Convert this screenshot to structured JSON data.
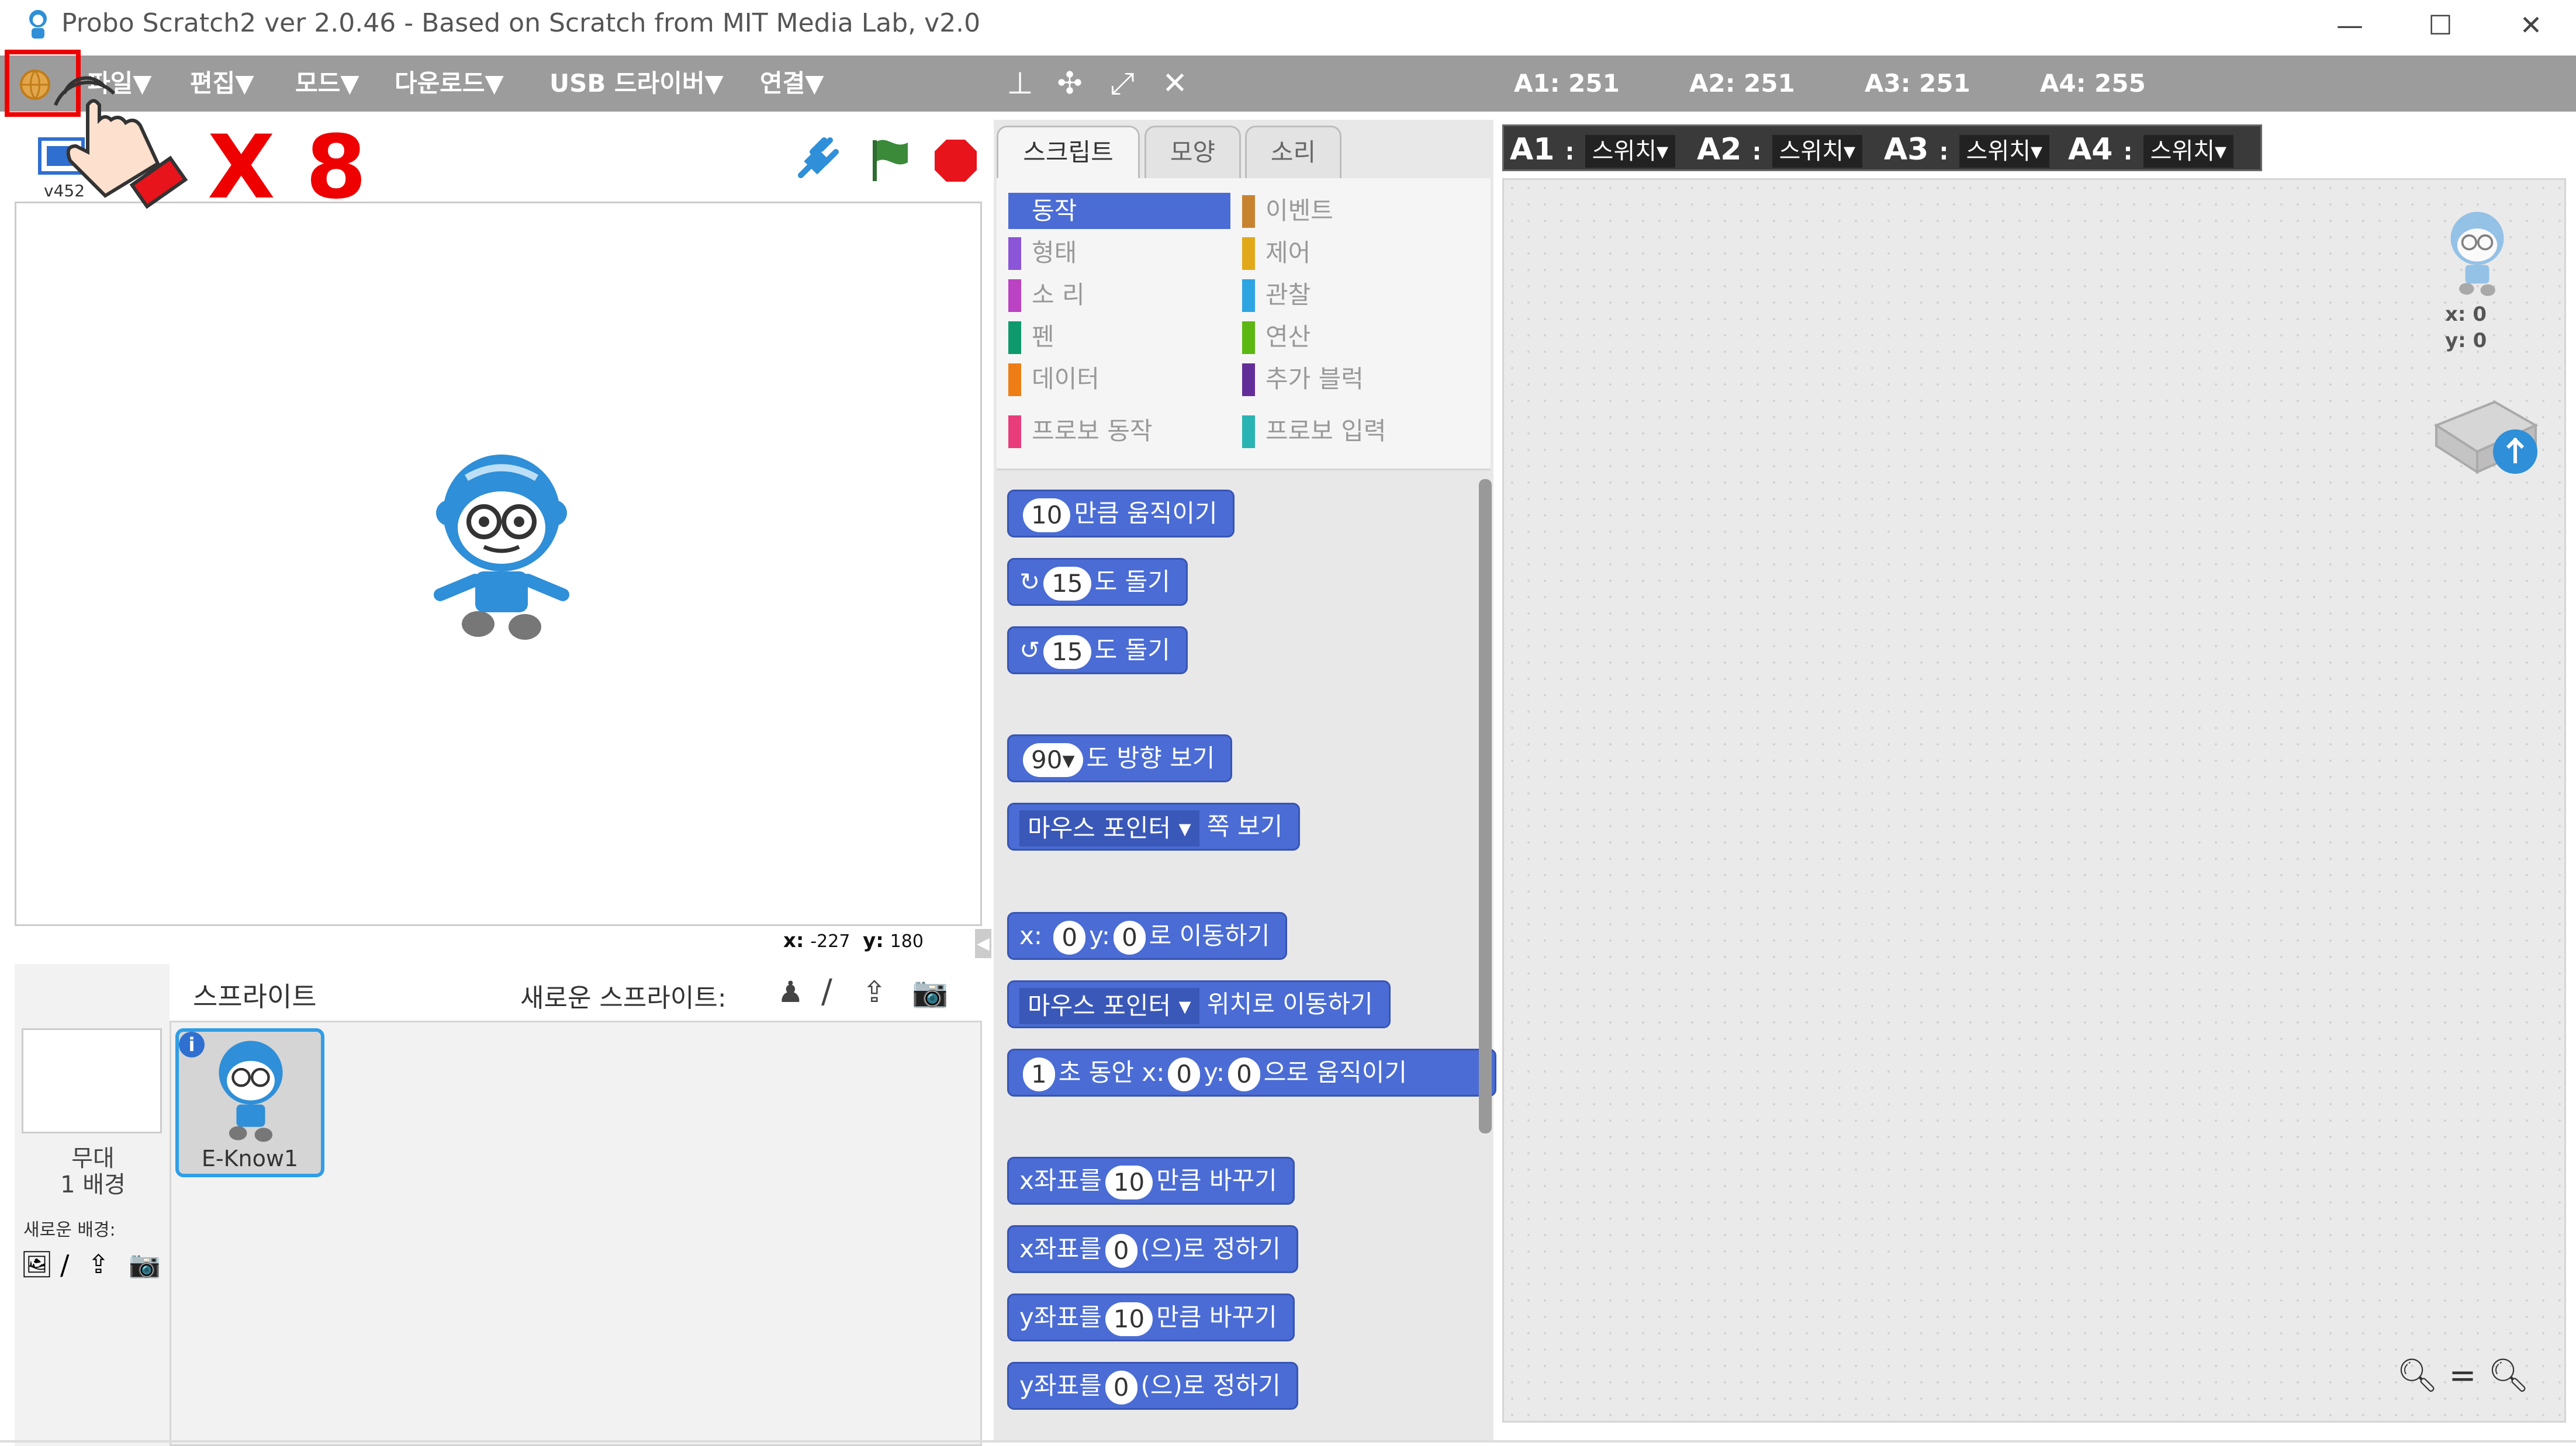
{
  "window": {
    "title": "Probo Scratch2 ver 2.0.46 - Based on Scratch from MIT Media Lab, v2.0",
    "minimize": "—",
    "maximize": "☐",
    "close": "✕"
  },
  "menu": {
    "items": [
      "파일▼",
      "편집▼",
      "모드▼",
      "다운로드▼",
      "USB 드라이버▼",
      "연결▼"
    ],
    "sensors": [
      "A1: 251",
      "A2: 251",
      "A3: 251",
      "A4: 255"
    ]
  },
  "stage": {
    "version": "v452",
    "coord_x_label": "x:",
    "coord_x": "-227",
    "coord_y_label": "y:",
    "coord_y": "180"
  },
  "annotation": {
    "repeat": "X 8"
  },
  "tabs": [
    "스크립트",
    "모양",
    "소리"
  ],
  "categories": {
    "left": [
      "동작",
      "형태",
      "소 리",
      "펜",
      "데이터",
      "프로보 동작"
    ],
    "right": [
      "이벤트",
      "제어",
      "관찰",
      "연산",
      "추가 블럭",
      "프로보 입력"
    ],
    "left_colors": [
      "#4a6cd4",
      "#8a55d7",
      "#bb42c3",
      "#0e9a6c",
      "#ee7d16",
      "#e83d7a"
    ],
    "right_colors": [
      "#c88330",
      "#e1a91a",
      "#2ca5e2",
      "#5cb712",
      "#632d99",
      "#2ab3b3"
    ]
  },
  "blocks": {
    "b1": {
      "v": "10",
      "t": "만큼 움직이기"
    },
    "b2": {
      "v": "15",
      "t": "도 돌기"
    },
    "b3": {
      "v": "15",
      "t": "도 돌기"
    },
    "b4": {
      "v": "90▾",
      "t": "도 방향 보기"
    },
    "b5": {
      "d": "마우스 포인터 ▾",
      "t": "쪽 보기"
    },
    "b6": {
      "a": "x:",
      "v1": "0",
      "b": "y:",
      "v2": "0",
      "t": "로 이동하기"
    },
    "b7": {
      "d": "마우스 포인터 ▾",
      "t": "위치로 이동하기"
    },
    "b8": {
      "v0": "1",
      "a": "초 동안 x:",
      "v1": "0",
      "b": "y:",
      "v2": "0",
      "t": "으로 움직이기"
    },
    "b9": {
      "a": "x좌표를",
      "v": "10",
      "t": "만큼 바꾸기"
    },
    "b10": {
      "a": "x좌표를",
      "v": "0",
      "t": "(으)로 정하기"
    },
    "b11": {
      "a": "y좌표를",
      "v": "10",
      "t": "만큼 바꾸기"
    },
    "b12": {
      "a": "y좌표를",
      "v": "0",
      "t": "(으)로 정하기"
    }
  },
  "switches": [
    {
      "label": "A1",
      "sep": ":",
      "value": "스위치▾"
    },
    {
      "label": "A2",
      "sep": ":",
      "value": "스위치▾"
    },
    {
      "label": "A3",
      "sep": ":",
      "value": "스위치▾"
    },
    {
      "label": "A4",
      "sep": ":",
      "value": "스위치▾"
    }
  ],
  "sprites": {
    "header": "스프라이트",
    "new_sprite": "새로운 스프라이트:",
    "stage_label": "무대",
    "backdrops": "1 배경",
    "new_backdrop": "새로운 배경:",
    "sprite1_name": "E-Know1",
    "info": "i"
  },
  "script_area": {
    "x": "x: 0",
    "y": "y: 0"
  }
}
